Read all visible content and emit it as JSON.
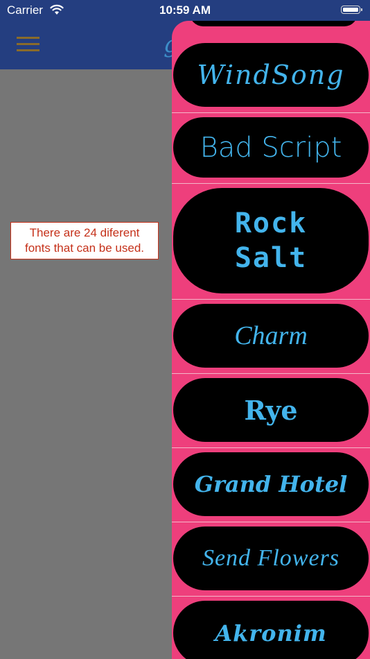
{
  "status_bar": {
    "carrier": "Carrier",
    "time": "10:59 AM",
    "wifi_icon": "wifi-icon",
    "battery_icon": "battery-full-icon"
  },
  "nav": {
    "menu_icon": "hamburger-menu-icon",
    "title_peek": "g",
    "colors": {
      "background": "#243e80",
      "menu": "#8a6b2a"
    }
  },
  "info": {
    "line1": "There are 24 diferent",
    "line2": "fonts that can be used."
  },
  "drawer": {
    "colors": {
      "background": "#ee3f7c",
      "pill": "#000000",
      "text": "#43b4ec"
    },
    "fonts": [
      {
        "label": "WindSong"
      },
      {
        "label": "Bad Script"
      },
      {
        "label_line1": "Rock",
        "label_line2": "Salt"
      },
      {
        "label": "Charm"
      },
      {
        "label": "Rye"
      },
      {
        "label": "Grand Hotel"
      },
      {
        "label": "Send Flowers"
      },
      {
        "label": "Akronim"
      }
    ]
  }
}
